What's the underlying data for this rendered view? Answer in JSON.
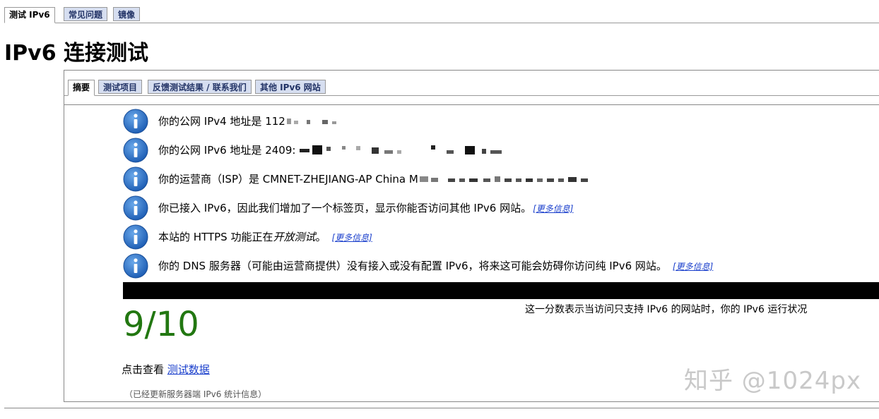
{
  "top_tabs": [
    {
      "label": "测试 IPv6",
      "active": true
    },
    {
      "label": "常见问题",
      "active": false
    },
    {
      "label": "镜像",
      "active": false
    }
  ],
  "page_title": "IPv6 连接测试",
  "sub_tabs": [
    {
      "label": "摘要",
      "active": true
    },
    {
      "label": "测试项目",
      "active": false
    },
    {
      "label": "反馈测试结果 / 联系我们",
      "active": false
    },
    {
      "label": "其他 IPv6 网站",
      "active": false
    }
  ],
  "info_icon": "info-icon",
  "info": {
    "ipv4": {
      "text": "你的公网 IPv4 地址是 112"
    },
    "ipv6": {
      "text": "你的公网 IPv6 地址是 2409:"
    },
    "isp": {
      "text": "你的运营商（ISP）是 CMNET-ZHEJIANG-AP China M"
    },
    "tab_added": {
      "text": "你已接入 IPv6，因此我们增加了一个标签页，显示你能否访问其他 IPv6 网站。",
      "link": "[更多信息]"
    },
    "https": {
      "text_before": "本站的 HTTPS 功能正在",
      "text_em": "开放测试",
      "text_after": "。",
      "link": "[更多信息]"
    },
    "dns": {
      "text": "你的 DNS 服务器（可能由运营商提供）没有接入或没有配置 IPv6，将来这可能会妨碍你访问纯 IPv6 网站。",
      "link": "[更多信息]"
    }
  },
  "score": {
    "value": "9/10",
    "description": "这一分数表示当访问只支持 IPv6 的网站时，你的 IPv6 运行状况",
    "color": "#227711"
  },
  "see_data": {
    "prefix": "点击查看",
    "link": "测试数据"
  },
  "updated_note": "（已经更新服务器端 IPv6 统计信息）",
  "watermark": "知乎 @1024px",
  "colors": {
    "tab_bg": "#d6def0",
    "link": "#1a3fcc",
    "info_icon": "#2f73c8"
  }
}
